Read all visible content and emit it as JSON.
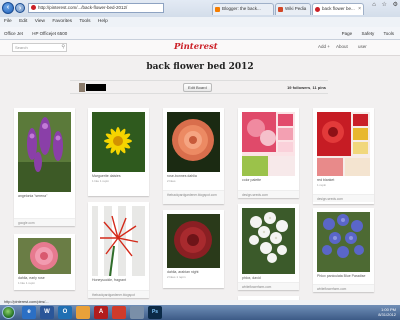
{
  "browser": {
    "address": "http://pinterest.com/.../back-flower-bed-2012/",
    "tabs": [
      {
        "label": "Blogger: the back...",
        "color": "#f57d00",
        "active": false
      },
      {
        "label": "Wiki Pedia",
        "color": "#d24726",
        "active": false
      },
      {
        "label": "back flower be...",
        "color": "#cb2027",
        "active": true
      }
    ],
    "menu": [
      "File",
      "Edit",
      "View",
      "Favorites",
      "Tools",
      "Help"
    ],
    "favorites": [
      "Office Jet",
      "HP Officejet 6500"
    ],
    "commands": [
      "Page",
      "Safety",
      "Tools"
    ],
    "status_url": "http://pinterest.com/pins/..."
  },
  "pinterest": {
    "search_placeholder": "Search",
    "logo": "Pinterest",
    "header_links": [
      "Add +",
      "About",
      "user"
    ]
  },
  "board": {
    "title": "back flower bed 2012",
    "edit_label": "Edit Board",
    "followers": "19 followers",
    "pins": "11 pins"
  },
  "pins": [
    {
      "desc": "angelonia \"serena\"",
      "meta": "",
      "source": "google.com",
      "img": "purple-spikes"
    },
    {
      "desc": "Marguerite daisies",
      "meta": "1 like  1 repin",
      "source": "",
      "img": "yellow-daisy"
    },
    {
      "desc": "rose-bonnes dahlia",
      "meta": "2 likes",
      "source": "thebackyardgardener.blogspot.com",
      "img": "salmon-dahlia"
    },
    {
      "desc": "color palette",
      "meta": "",
      "source": "design-seeds.com",
      "img": "palette-pink"
    },
    {
      "desc": "red blanket",
      "meta": "1 repin",
      "source": "design-seeds.com",
      "img": "palette-red"
    },
    {
      "desc": "dahlia, early rose",
      "meta": "1 like  1 repin",
      "source": "",
      "img": "pink-dahlia"
    },
    {
      "desc": "Honeysuckle, fragrant",
      "meta": "",
      "source": "thebackyardgardener.blogspot",
      "img": "red-spider"
    },
    {
      "desc": "dahlia, arabian night",
      "meta": "2 likes  1 repin",
      "source": "thebackyardgardener.blogspot.com",
      "img": "dark-dahlia"
    },
    {
      "desc": "phlox, david",
      "meta": "",
      "source": "whiteflowerfarm.com",
      "img": "white-phlox"
    },
    {
      "desc": "Phlox paniculata Blue Paradise",
      "meta": "",
      "source": "whiteflowerfarm.com",
      "img": "blue-phlox"
    },
    {
      "desc": "",
      "meta": "",
      "source": "",
      "img": "orange-dahlia"
    }
  ],
  "taskbar": {
    "apps": [
      {
        "name": "ie-icon",
        "glyph": "e",
        "color": "#2b6fc4"
      },
      {
        "name": "word-icon",
        "glyph": "W",
        "color": "#2a5699"
      },
      {
        "name": "outlook-icon",
        "glyph": "O",
        "color": "#1f6fb3"
      },
      {
        "name": "acrobat-icon",
        "glyph": "A",
        "color": "#b21d1d"
      },
      {
        "name": "ps-icon",
        "glyph": "Ps",
        "color": "#0b2a47"
      }
    ],
    "time": "1:00 PM",
    "date": "8/31/2012"
  }
}
